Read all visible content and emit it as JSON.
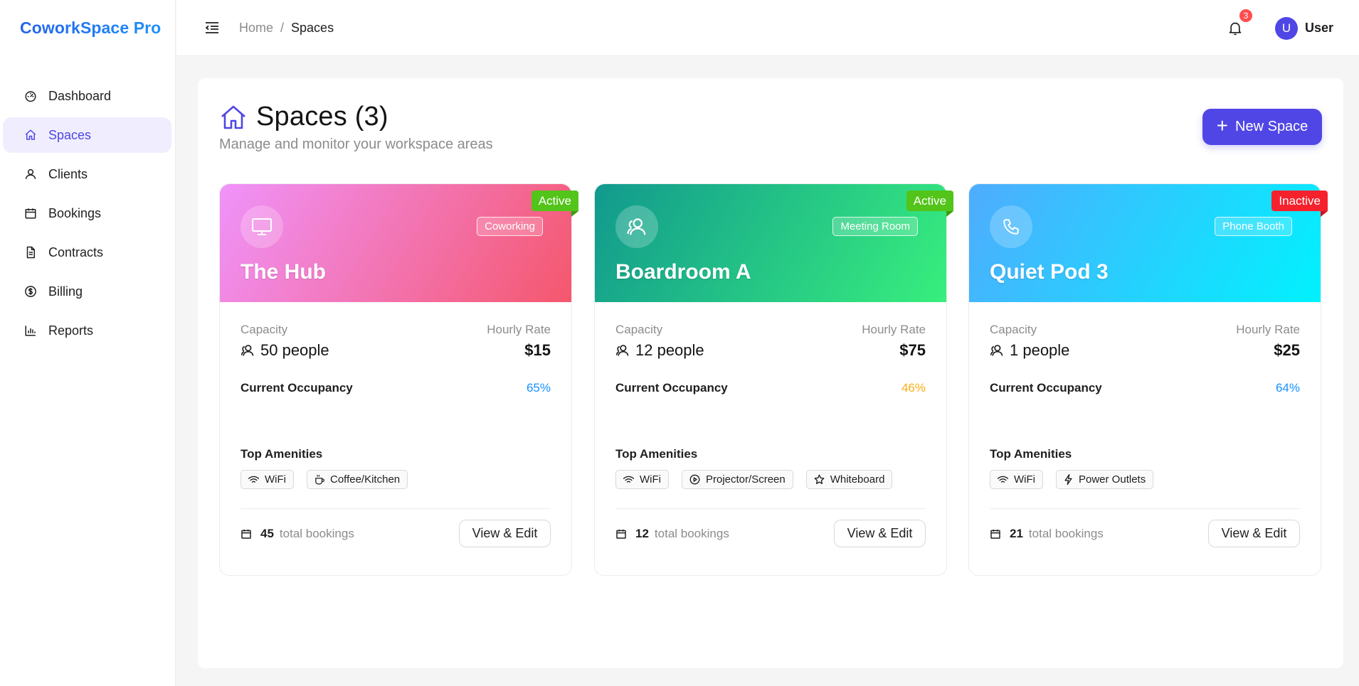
{
  "brand": "CoworkSpace Pro",
  "nav": [
    {
      "label": "Dashboard",
      "icon": "dashboard-icon"
    },
    {
      "label": "Spaces",
      "icon": "home-icon",
      "active": true
    },
    {
      "label": "Clients",
      "icon": "user-icon"
    },
    {
      "label": "Bookings",
      "icon": "calendar-icon"
    },
    {
      "label": "Contracts",
      "icon": "file-icon"
    },
    {
      "label": "Billing",
      "icon": "dollar-icon"
    },
    {
      "label": "Reports",
      "icon": "bar-chart-icon"
    }
  ],
  "header": {
    "breadcrumb_home": "Home",
    "breadcrumb_sep": "/",
    "breadcrumb_current": "Spaces",
    "notification_count": "3",
    "avatar_initial": "U",
    "username": "User"
  },
  "page": {
    "title": "Spaces (3)",
    "subtitle": "Manage and monitor your workspace areas",
    "new_button": "New Space"
  },
  "labels": {
    "capacity": "Capacity",
    "hourly_rate": "Hourly Rate",
    "current_occupancy": "Current Occupancy",
    "top_amenities": "Top Amenities",
    "total_bookings": "total bookings",
    "view_edit": "View & Edit"
  },
  "spaces": [
    {
      "name": "The Hub",
      "type": "Coworking",
      "status": "Active",
      "icon": "monitor-icon",
      "capacity": "50 people",
      "rate": "$15",
      "occupancy": "65%",
      "occupancy_color": "#1890ff",
      "amenities": [
        {
          "label": "WiFi",
          "icon": "wifi-icon"
        },
        {
          "label": "Coffee/Kitchen",
          "icon": "coffee-icon"
        }
      ],
      "bookings": "45",
      "gradient": [
        "#f093fb",
        "#f5576c"
      ]
    },
    {
      "name": "Boardroom A",
      "type": "Meeting Room",
      "status": "Active",
      "icon": "team-icon",
      "capacity": "12 people",
      "rate": "$75",
      "occupancy": "46%",
      "occupancy_color": "#faad14",
      "amenities": [
        {
          "label": "WiFi",
          "icon": "wifi-icon"
        },
        {
          "label": "Projector/Screen",
          "icon": "play-circle-icon"
        },
        {
          "label": "Whiteboard",
          "icon": "star-icon"
        }
      ],
      "bookings": "12",
      "gradient": [
        "#11998e",
        "#38ef7d"
      ]
    },
    {
      "name": "Quiet Pod 3",
      "type": "Phone Booth",
      "status": "Inactive",
      "icon": "phone-icon",
      "capacity": "1 people",
      "rate": "$25",
      "occupancy": "64%",
      "occupancy_color": "#1890ff",
      "amenities": [
        {
          "label": "WiFi",
          "icon": "wifi-icon"
        },
        {
          "label": "Power Outlets",
          "icon": "bolt-icon"
        }
      ],
      "bookings": "21",
      "gradient": [
        "#4facfe",
        "#00f2fe"
      ]
    }
  ]
}
